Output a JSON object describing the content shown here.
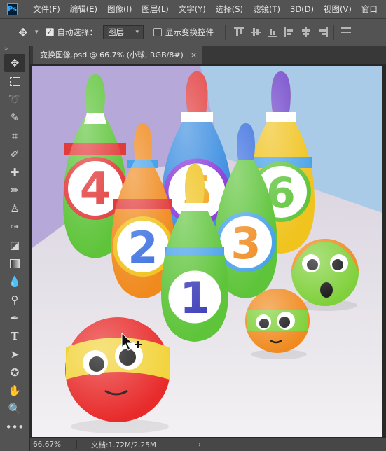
{
  "app": {
    "logo": "Ps"
  },
  "menu": [
    "文件(F)",
    "编辑(E)",
    "图像(I)",
    "图层(L)",
    "文字(Y)",
    "选择(S)",
    "滤镜(T)",
    "3D(D)",
    "视图(V)",
    "窗口"
  ],
  "options": {
    "auto_select_label": "自动选择：",
    "auto_select_checked": true,
    "auto_select_target": "图层",
    "show_transform_label": "显示变换控件",
    "show_transform_checked": false
  },
  "document_tab": {
    "title": "变换图像.psd @ 66.7% (小球, RGB/8#)",
    "close": "×"
  },
  "tools": [
    "move-tool",
    "marquee-tool",
    "lasso-tool",
    "quick-select-tool",
    "crop-tool",
    "eyedropper-tool",
    "healing-brush-tool",
    "brush-tool",
    "clone-stamp-tool",
    "history-brush-tool",
    "eraser-tool",
    "gradient-tool",
    "blur-tool",
    "dodge-tool",
    "pen-tool",
    "type-tool",
    "path-select-tool",
    "shape-tool",
    "hand-tool",
    "zoom-tool",
    "more-tools"
  ],
  "canvas": {
    "pin_numbers": [
      "4",
      "5",
      "6",
      "2",
      "3",
      "1"
    ],
    "colors": {
      "wall_left": "#b6a9d9",
      "wall_right": "#aacbe8",
      "floor": "#ece9ec"
    }
  },
  "status": {
    "zoom": "66.67%",
    "doc": "文档:1.72M/2.25M",
    "arrow": "›"
  }
}
